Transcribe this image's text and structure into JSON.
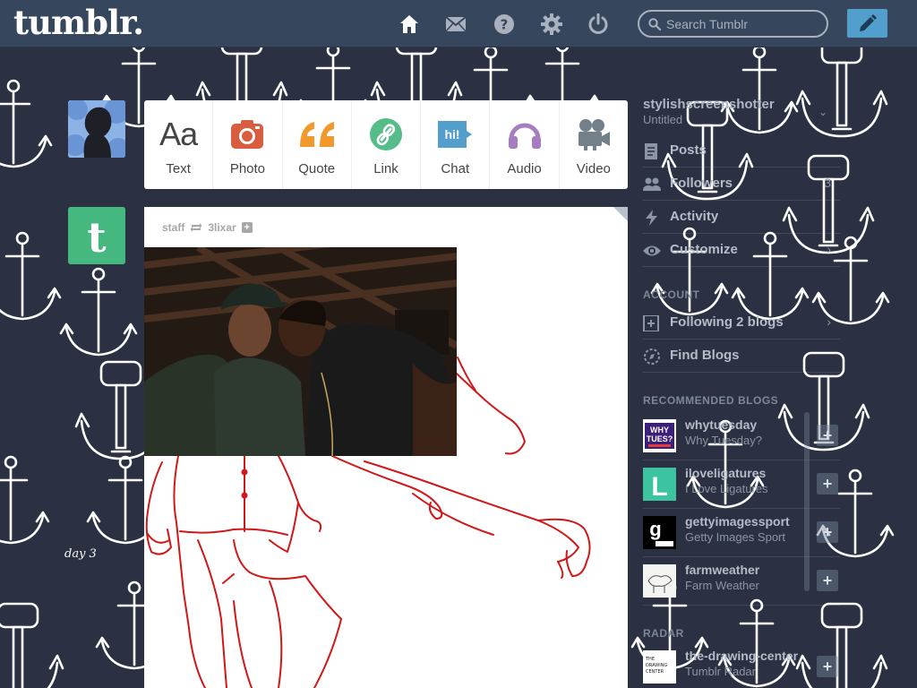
{
  "header": {
    "logo": "tumblr.",
    "nav_icons": [
      "home-icon",
      "mail-icon",
      "help-icon",
      "gear-icon",
      "power-icon"
    ],
    "search_placeholder": "Search Tumblr",
    "compose_icon": "pencil-icon"
  },
  "post_types": [
    {
      "label": "Text",
      "icon": "text-aa-icon",
      "color": "#444444"
    },
    {
      "label": "Photo",
      "icon": "camera-icon",
      "color": "#d95e40"
    },
    {
      "label": "Quote",
      "icon": "quote-icon",
      "color": "#f2992e"
    },
    {
      "label": "Link",
      "icon": "link-icon",
      "color": "#56bc8a"
    },
    {
      "label": "Chat",
      "icon": "chat-icon",
      "color": "#529ecc"
    },
    {
      "label": "Audio",
      "icon": "headphones-icon",
      "color": "#a77dc2"
    },
    {
      "label": "Video",
      "icon": "video-camera-icon",
      "color": "#748089"
    }
  ],
  "post": {
    "author": "staff",
    "reblog_icon": "reblog-icon",
    "reblogged_from": "3lixar",
    "follow_icon": "plus-icon"
  },
  "sidebar": {
    "blog_name": "stylishscreenshotter",
    "blog_title": "Untitled",
    "items": [
      {
        "label": "Posts",
        "icon": "posts-icon",
        "meta": ""
      },
      {
        "label": "Followers",
        "icon": "followers-icon",
        "meta": "3"
      },
      {
        "label": "Activity",
        "icon": "activity-icon",
        "meta": ""
      },
      {
        "label": "Customize",
        "icon": "eye-icon",
        "meta": ""
      }
    ],
    "account_heading": "ACCOUNT",
    "account_items": [
      {
        "label": "Following 2 blogs",
        "icon": "following-icon"
      },
      {
        "label": "Find Blogs",
        "icon": "compass-icon"
      }
    ],
    "recommended_heading": "RECOMMENDED BLOGS",
    "recommended": [
      {
        "name": "whytuesday",
        "title": "Why Tuesday?"
      },
      {
        "name": "iloveligatures",
        "title": "I Love Ligatures"
      },
      {
        "name": "gettyimagessport",
        "title": "Getty Images Sport"
      },
      {
        "name": "farmweather",
        "title": "Farm Weather"
      }
    ],
    "radar_heading": "RADAR",
    "radar": {
      "name": "the-drawing-center",
      "title": "Tumblr Radar"
    }
  },
  "wallpaper_note": "day 3",
  "colors": {
    "background": "#2b3142",
    "header": "#36465d",
    "compose": "#529ecc",
    "drawing_lines": "#d01818"
  }
}
